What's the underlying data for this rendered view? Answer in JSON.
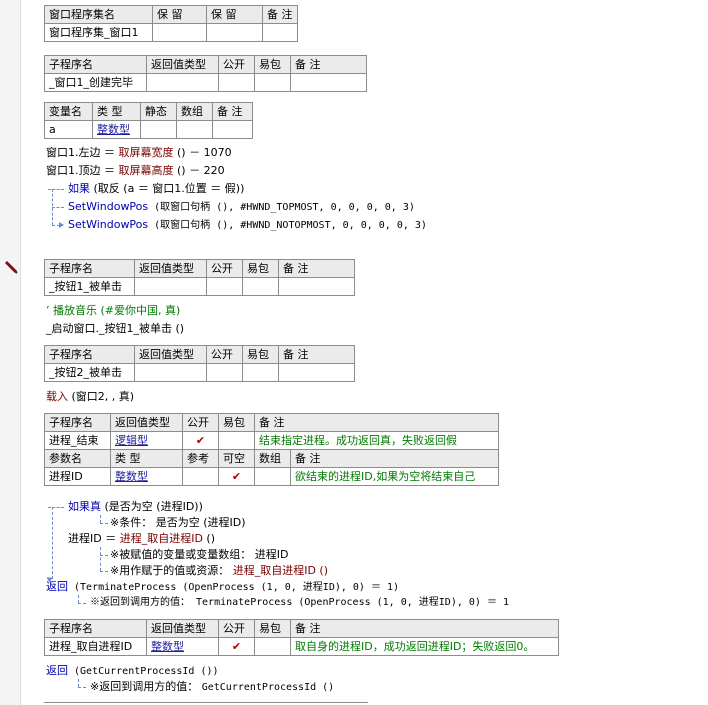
{
  "set_header": {
    "c1": "窗口程序集名",
    "c2": "保 留",
    "c3": "保 留",
    "c4": "备 注"
  },
  "set_row": {
    "name": "窗口程序集_窗口1"
  },
  "sub_header": {
    "c1": "子程序名",
    "c2": "返回值类型",
    "c3": "公开",
    "c4": "易包",
    "c5": "备 注"
  },
  "sub1": {
    "name": "_窗口1_创建完毕"
  },
  "var_header": {
    "c1": "变量名",
    "c2": "类 型",
    "c3": "静态",
    "c4": "数组",
    "c5": "备 注"
  },
  "var1": {
    "name": "a",
    "type": "整数型"
  },
  "code1": {
    "l1a": "窗口1.左边 ＝ ",
    "l1b": "取屏幕宽度",
    "l1c": " () － 1070",
    "l2a": "窗口1.顶边 ＝ ",
    "l2b": "取屏幕高度",
    "l2c": " () － 220",
    "l3a": "如果",
    "l3b": " (取反 (a ＝ 窗口1.位置 ＝ 假))",
    "l4a": "SetWindowPos",
    "l4b": " (取窗口句柄 (), #HWND_TOPMOST, 0, 0, 0, 0, 3)",
    "l5a": "SetWindowPos",
    "l5b": " (取窗口句柄 (), #HWND_NOTOPMOST, 0, 0, 0, 0, 3)"
  },
  "sub2": {
    "name": "_按钮1_被单击"
  },
  "code2": {
    "l1": "’ 播放音乐 (#爱你中国, 真)",
    "l2": "_启动窗口._按钮1_被单击 ()"
  },
  "sub3": {
    "name": "_按钮2_被单击"
  },
  "code3": {
    "l1a": "载入",
    "l1b": " (窗口2, , 真)"
  },
  "proc_end": {
    "name": "进程_结束",
    "ret": "逻辑型",
    "public": "✔",
    "note": "结束指定进程。成功返回真，失败返回假",
    "param_header": {
      "c1": "参数名",
      "c2": "类 型",
      "c3": "参考",
      "c4": "可空",
      "c5": "数组",
      "c6": "备 注"
    },
    "param": {
      "name": "进程ID",
      "type": "整数型",
      "nullable": "✔",
      "note": "欲结束的进程ID,如果为空将结束自己"
    }
  },
  "code4": {
    "l1a": "如果真",
    "l1b": " (是否为空 (进程ID))",
    "l2": "※条件： 是否为空 (进程ID)",
    "l3a": "进程ID ＝ ",
    "l3b": "进程_取自进程ID",
    "l3c": " ()",
    "l4": "※被赋值的变量或变量数组： 进程ID",
    "l5a": "※用作赋于的值或资源： ",
    "l5b": "进程_取自进程ID ()",
    "l6a": "返回",
    "l6b": " (TerminateProcess (OpenProcess (1, 0, 进程ID), 0) ＝ 1)",
    "l7": "※返回到调用方的值： TerminateProcess (OpenProcess (1, 0, 进程ID), 0) ＝ 1"
  },
  "proc_get": {
    "name": "进程_取自进程ID",
    "ret": "整数型",
    "public": "✔",
    "note": "取自身的进程ID，成功返回进程ID；失败返回0。"
  },
  "code5": {
    "l1a": "返回",
    "l1b": " (GetCurrentProcessId ())",
    "l2a": "※返回到调用方的值： ",
    "l2b": "GetCurrentProcessId ()"
  },
  "icons": {
    "pen": "pen-icon",
    "check": "check-icon"
  },
  "colors": {
    "keyword": "#0000b0",
    "comment": "#007a00",
    "type_link": "#1e1ea0",
    "flow_line": "#6a8acb"
  }
}
